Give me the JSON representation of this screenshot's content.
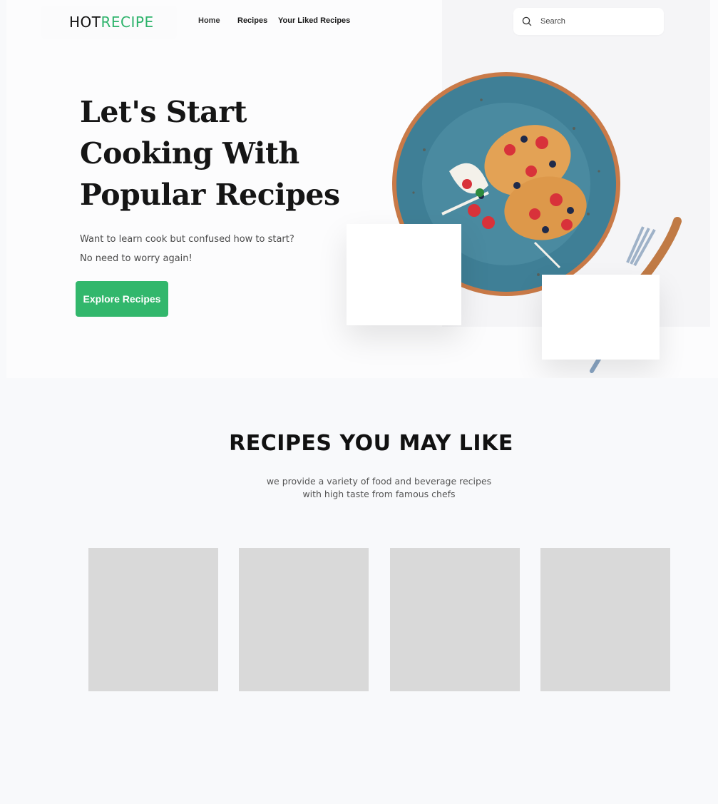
{
  "header": {
    "logo_primary": "HOT",
    "logo_accent": "RECIPE",
    "nav": {
      "home": "Home",
      "recipes": "Recipes",
      "liked": "Your Liked Recipes"
    },
    "search": {
      "placeholder": "Search",
      "icon": "search-icon"
    }
  },
  "hero": {
    "headline_lines": [
      "Let's Start",
      "Cooking With",
      "Popular Recipes"
    ],
    "subtitle_lines": [
      "Want to learn cook but confused how to start?",
      "No need to worry again!"
    ],
    "cta_label": "Explore Recipes"
  },
  "recipes_section": {
    "title": "RECIPES YOU MAY LIKE",
    "subtitle_lines": [
      "we provide a variety of food and beverage recipes",
      "with high taste from famous chefs"
    ],
    "card_count": 4
  },
  "colors": {
    "accent": "#2db36b",
    "button": "#32b76c",
    "card_placeholder": "#d9d9d9",
    "plate": "#3f7f96"
  }
}
